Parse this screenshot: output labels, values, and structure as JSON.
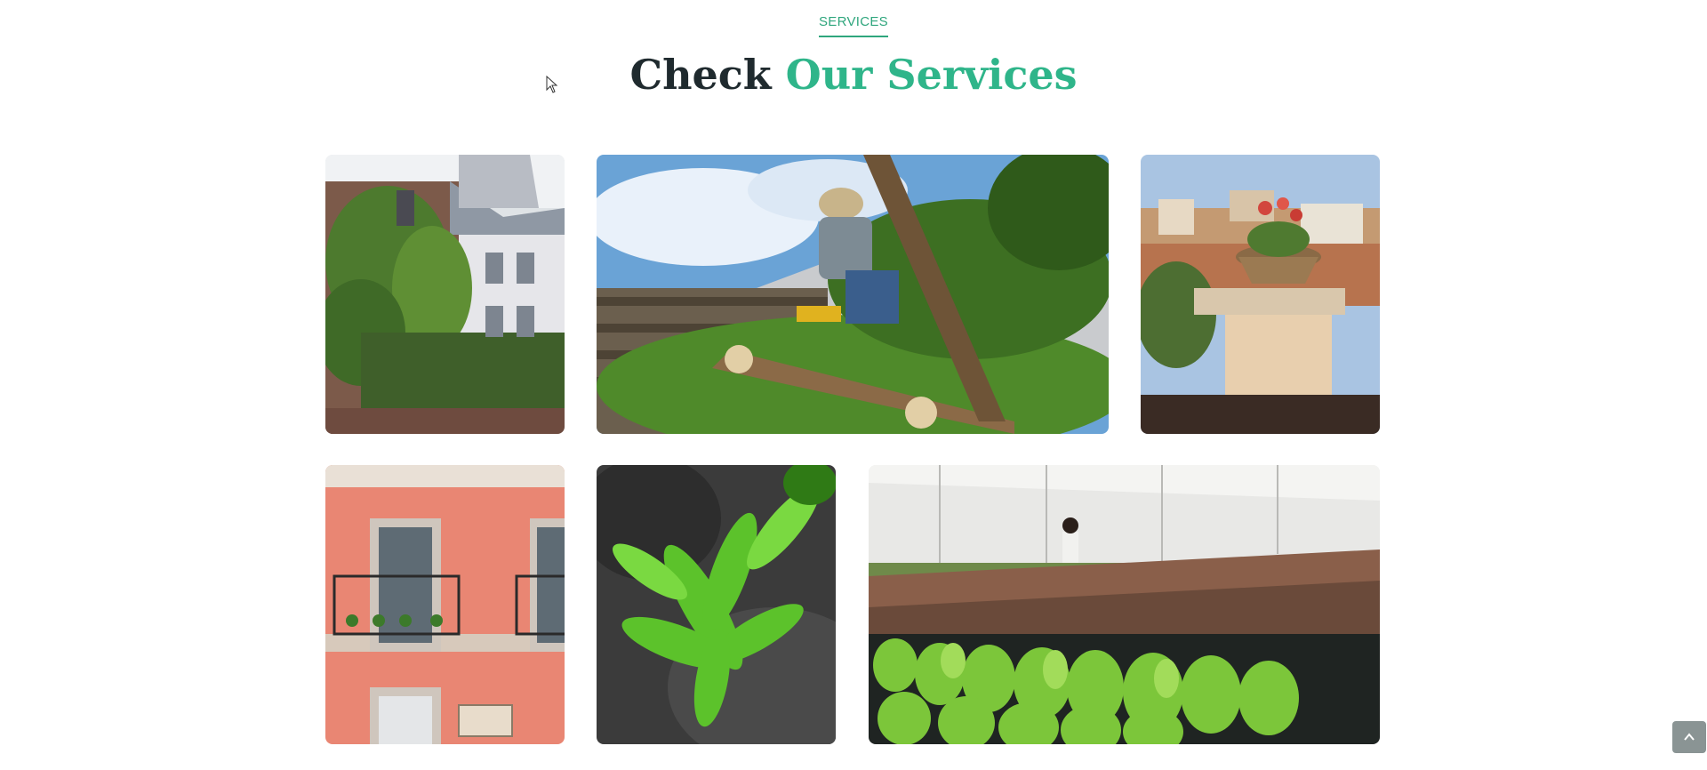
{
  "section": {
    "eyebrow": "SERVICES",
    "title_plain": "Check ",
    "title_accent": "Our Services"
  },
  "colors": {
    "accent": "#2fb58a",
    "heading": "#1f2a2e",
    "scroll_button": "#8a9494"
  },
  "icons": {
    "scroll_top": "chevron-up-icon",
    "cursor": "mouse-pointer-icon"
  }
}
